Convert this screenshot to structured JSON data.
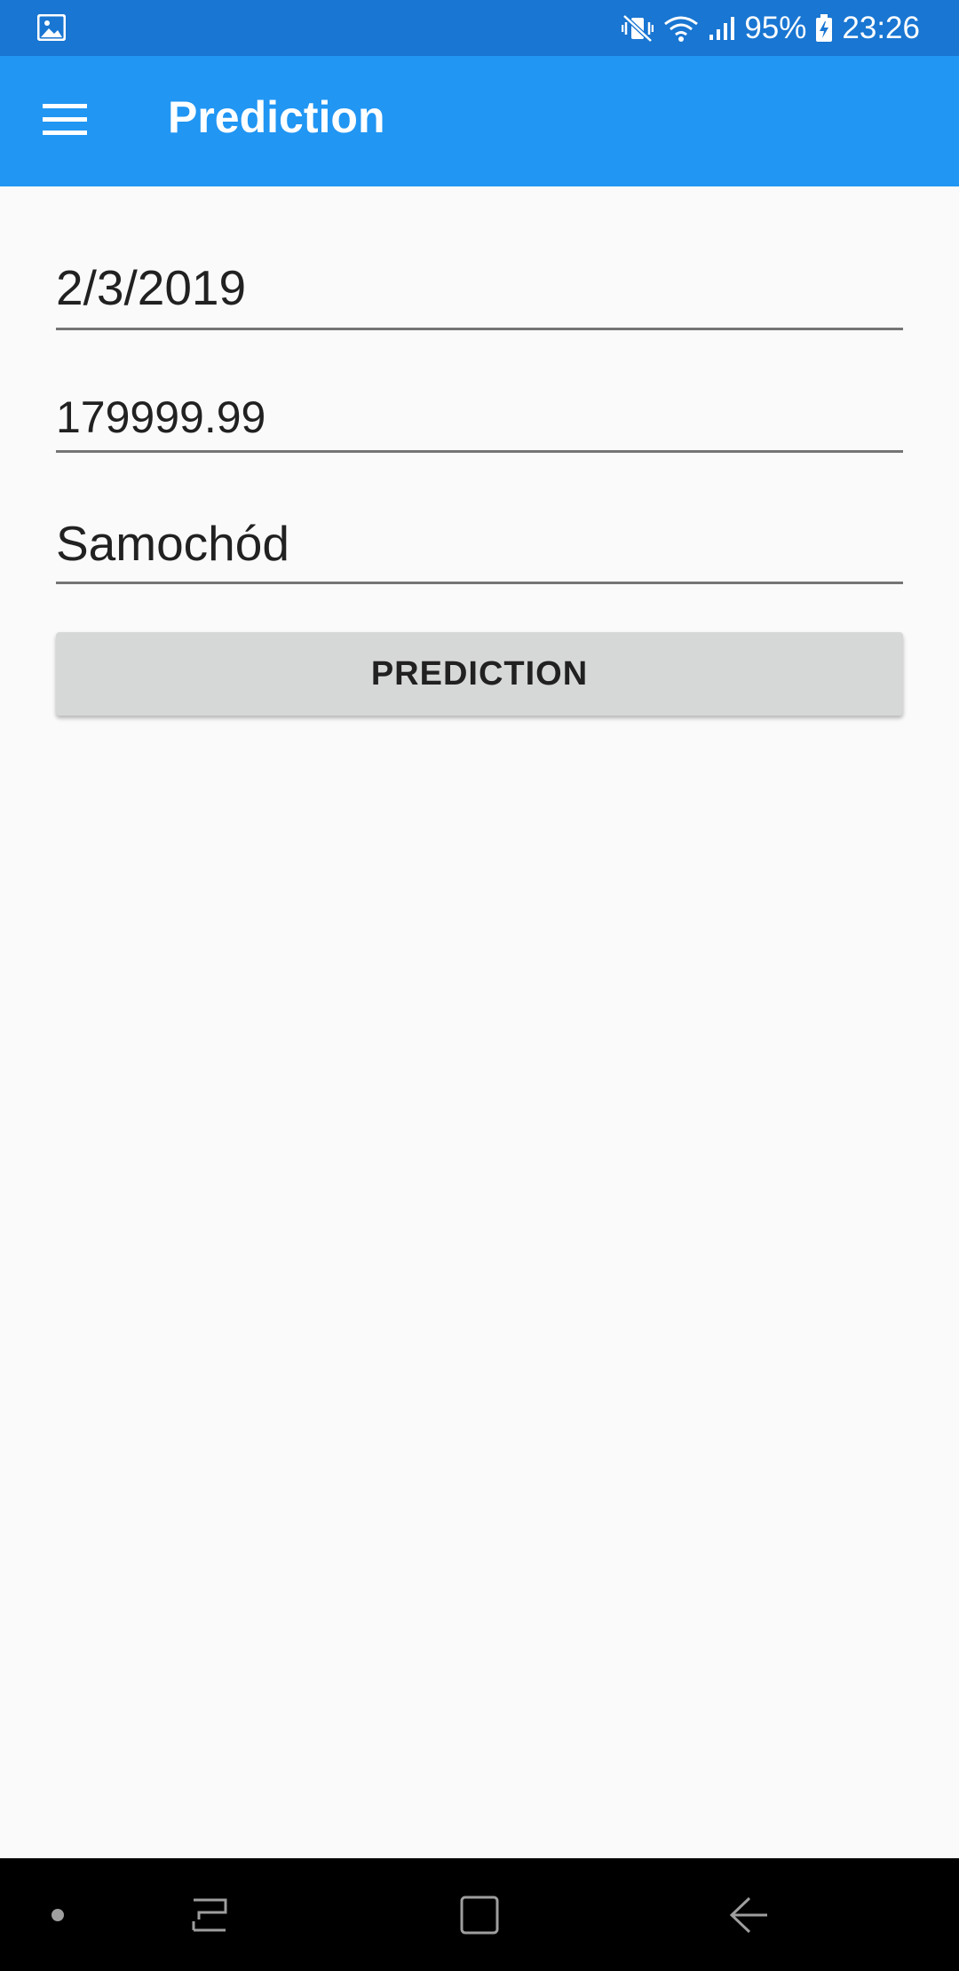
{
  "status_bar": {
    "battery_percent": "95%",
    "time": "23:26",
    "icons": [
      "gallery-icon",
      "mute-vibrate-icon",
      "wifi-icon",
      "signal-icon",
      "battery-charging-icon"
    ]
  },
  "app_bar": {
    "title": "Prediction",
    "menu_icon": "hamburger-menu-icon"
  },
  "form": {
    "date_value": "2/3/2019",
    "amount_value": "179999.99",
    "category_value": "Samochód",
    "button_label": "PREDICTION"
  },
  "nav_bar": {
    "icons": [
      "dot-icon",
      "recent-apps-icon",
      "home-icon",
      "back-icon"
    ]
  },
  "colors": {
    "status_bar": "#1976d2",
    "app_bar": "#2196f3",
    "background": "#fafafa",
    "button": "#d6d7d7",
    "nav_bar": "#000000"
  }
}
